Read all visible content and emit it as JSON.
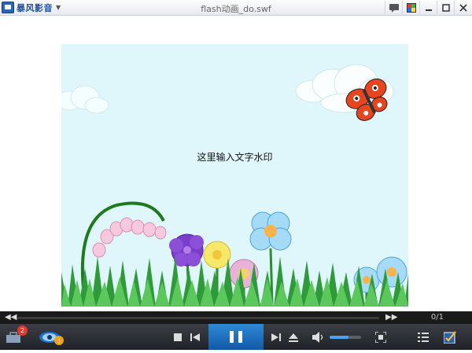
{
  "titlebar": {
    "app_name": "暴风影音",
    "caret": "▼",
    "title": "flash动画_do.swf",
    "buttons": [
      {
        "name": "chat-icon",
        "glyph": "💬"
      },
      {
        "name": "skin-icon",
        "glyph": "▦"
      },
      {
        "name": "minimize-icon",
        "glyph": "—"
      },
      {
        "name": "maximize-icon",
        "glyph": "□"
      },
      {
        "name": "close-icon",
        "glyph": "✕"
      }
    ]
  },
  "video": {
    "watermark_text": "这里输入文字水印"
  },
  "seek": {
    "left_glyph": "◀◀",
    "right_glyph": "▶▶",
    "time": "0/1",
    "progress": 0
  },
  "controls": {
    "badge_count": "2",
    "volume_level": 0.6
  },
  "colors": {
    "sky": "#dff7fb",
    "grass": "#2e8b2e",
    "accent": "#1f6fc2"
  }
}
